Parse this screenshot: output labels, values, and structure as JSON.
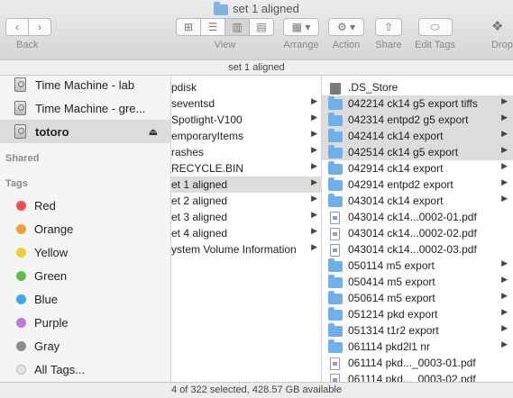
{
  "window": {
    "title": "set 1 aligned",
    "title_icon": "folder-icon"
  },
  "toolbar": {
    "back_label": "Back",
    "view_label": "View",
    "arrange_label": "Arrange",
    "action_label": "Action",
    "share_label": "Share",
    "edit_tags_label": "Edit Tags",
    "dropbox_label": "Drop",
    "back_glyph": "‹",
    "forward_glyph": "›",
    "view_glyphs": [
      "⊞",
      "☰",
      "▥",
      "▤"
    ],
    "arrange_glyph": "▦ ▾",
    "action_glyph": "⚙ ▾",
    "share_glyph": "⇧",
    "edit_tags_glyph": "⬭",
    "dropbox_glyph": "❖"
  },
  "pathbar": {
    "label": "set 1 aligned"
  },
  "sidebar": {
    "devices": [
      {
        "label": "Time Machine - lab",
        "icon": "drive-icon"
      },
      {
        "label": "Time Machine - gre...",
        "icon": "drive-icon"
      },
      {
        "label": "totoro",
        "icon": "drive-icon",
        "selected": true,
        "eject": "⏏"
      }
    ],
    "shared_header": "Shared",
    "tags_header": "Tags",
    "tags": [
      {
        "label": "Red",
        "color": "#f24e4e"
      },
      {
        "label": "Orange",
        "color": "#f0a030"
      },
      {
        "label": "Yellow",
        "color": "#f0d030"
      },
      {
        "label": "Green",
        "color": "#5bc244"
      },
      {
        "label": "Blue",
        "color": "#3aa9f0"
      },
      {
        "label": "Purple",
        "color": "#c27ad8"
      },
      {
        "label": "Gray",
        "color": "#8c8c8c"
      },
      {
        "label": "All Tags...",
        "color": "#e4e4e4"
      }
    ]
  },
  "column2": {
    "items": [
      {
        "label": "pdisk",
        "has_children": false
      },
      {
        "label": "seventsd",
        "has_children": true
      },
      {
        "label": "Spotlight-V100",
        "has_children": true
      },
      {
        "label": "emporaryItems",
        "has_children": true
      },
      {
        "label": "rashes",
        "has_children": true
      },
      {
        "label": "RECYCLE.BIN",
        "has_children": true
      },
      {
        "label": "et 1 aligned",
        "has_children": true,
        "selected": true
      },
      {
        "label": "et 2 aligned",
        "has_children": true
      },
      {
        "label": "et 3 aligned",
        "has_children": true
      },
      {
        "label": "et 4 aligned",
        "has_children": true
      },
      {
        "label": "ystem Volume Information",
        "has_children": true
      }
    ]
  },
  "column3": {
    "items": [
      {
        "label": ".DS_Store",
        "kind": "file"
      },
      {
        "label": "042214 ck14 g5 export tiffs",
        "kind": "folder",
        "selected": true
      },
      {
        "label": "042314 entpd2 g5 export",
        "kind": "folder",
        "selected": true
      },
      {
        "label": "042414 ck14 export",
        "kind": "folder",
        "selected": true
      },
      {
        "label": "042514 ck14 g5 export",
        "kind": "folder",
        "selected": true
      },
      {
        "label": "042914 ck14 export",
        "kind": "folder"
      },
      {
        "label": "042914 entpd2 export",
        "kind": "folder"
      },
      {
        "label": "043014 ck14 export",
        "kind": "folder"
      },
      {
        "label": "043014 ck14...0002-01.pdf",
        "kind": "pdf"
      },
      {
        "label": "043014 ck14...0002-02.pdf",
        "kind": "pdf"
      },
      {
        "label": "043014 ck14...0002-03.pdf",
        "kind": "pdf"
      },
      {
        "label": "050114 m5 export",
        "kind": "folder"
      },
      {
        "label": "050414 m5 export",
        "kind": "folder"
      },
      {
        "label": "050614 m5 export",
        "kind": "folder"
      },
      {
        "label": "051214 pkd export",
        "kind": "folder"
      },
      {
        "label": "051314 t1r2 export",
        "kind": "folder"
      },
      {
        "label": "061114 pkd2l1 nr",
        "kind": "folder"
      },
      {
        "label": "061114 pkd..._0003-01.pdf",
        "kind": "pdf"
      },
      {
        "label": "061114 pkd..._0003-02.pdf",
        "kind": "pdf"
      }
    ]
  },
  "statusbar": {
    "text": "4 of 322 selected, 428.57 GB available"
  }
}
